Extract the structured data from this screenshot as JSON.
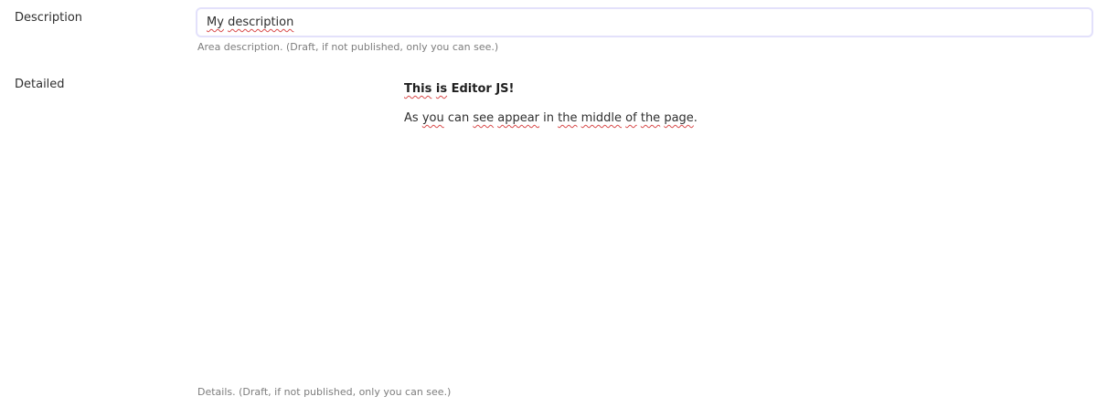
{
  "form": {
    "description": {
      "label": "Description",
      "value": "My description",
      "help": "Area description. (Draft, if not published, only you can see.)"
    },
    "detailed": {
      "label": "Detailed",
      "help": "Details. (Draft, if not published, only you can see.)",
      "editor": {
        "heading": "This is Editor JS!",
        "paragraph": "As you can see appear in the middle of the page."
      }
    }
  },
  "colors": {
    "input_border": "#e3e1fb",
    "spellcheck_underline": "#d84a4a",
    "help_text": "#7d7d7d"
  }
}
